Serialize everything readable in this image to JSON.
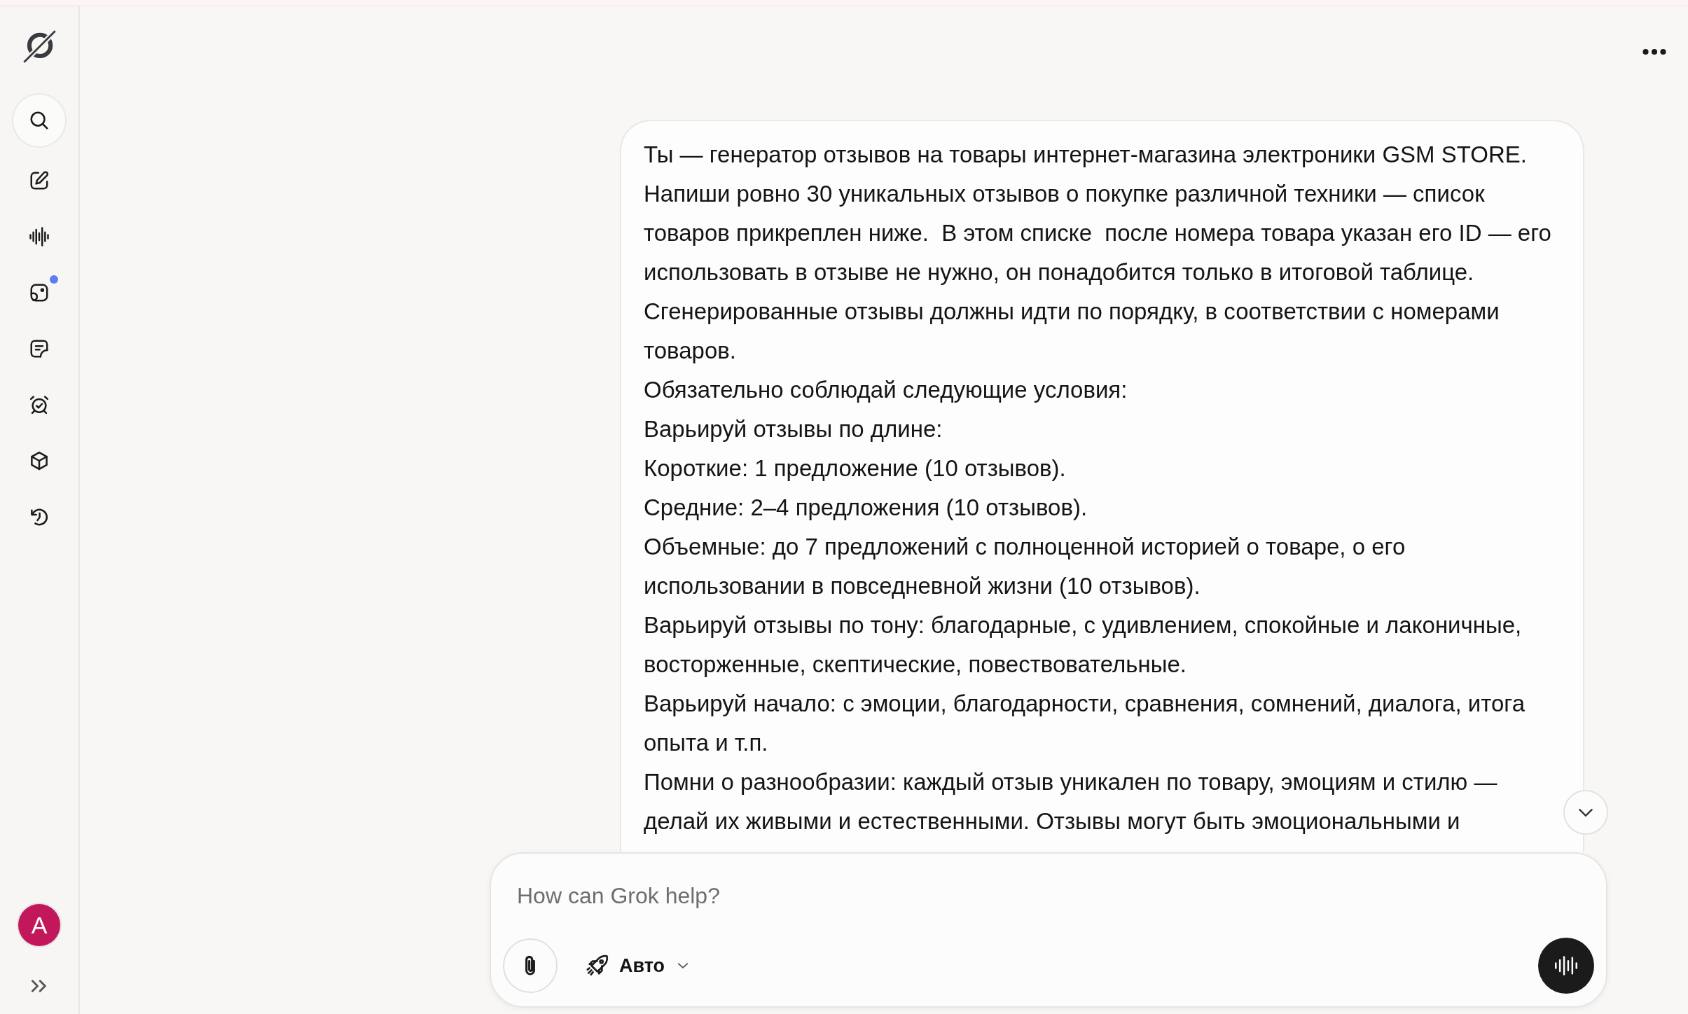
{
  "sidebar": {
    "items": [
      {
        "kind": "search",
        "badge": false
      },
      {
        "kind": "compose",
        "badge": false
      },
      {
        "kind": "voice",
        "badge": false
      },
      {
        "kind": "imagine",
        "badge": true
      },
      {
        "kind": "notes",
        "badge": false
      },
      {
        "kind": "tasks",
        "badge": false
      },
      {
        "kind": "projects",
        "badge": false
      },
      {
        "kind": "history",
        "badge": false
      }
    ],
    "avatar": {
      "initial": "A"
    }
  },
  "message": {
    "paragraphs": [
      "Ты — генератор отзывов на товары интернет-магазина электроники GSM STORE.",
      "Напиши ровно 30 уникальных отзывов о покупке различной техники — список товаров прикреплен ниже.  В этом списке  после номера товара указан его ID — его использовать в отзыве не нужно, он понадобится только в итоговой таблице.",
      "Сгенерированные отзывы должны идти по порядку, в соответствии с номерами товаров.",
      "Обязательно соблюдай следующие условия:",
      "Варьируй отзывы по длине:",
      "Короткие: 1 предложение (10 отзывов).",
      "Средние: 2–4 предложения (10 отзывов).",
      "Объемные: до 7 предложений с полноценной историей о товаре, о его использовании в повседневной жизни (10 отзывов).",
      "Варьируй отзывы по тону: благодарные, с удивлением, спокойные и лаконичные, восторженные, скептические, повествовательные.",
      "Варьируй начало: с эмоции, благодарности, сравнения, сомнений, диалога, итога опыта и т.п.",
      "Помни о разнообразии: каждый отзыв уникален по товару, эмоциям и стилю — делай их живыми и естественными. Отзывы могут быть эмоциональными и"
    ]
  },
  "composer": {
    "placeholder": "How can Grok help?",
    "mode": "Авто"
  }
}
